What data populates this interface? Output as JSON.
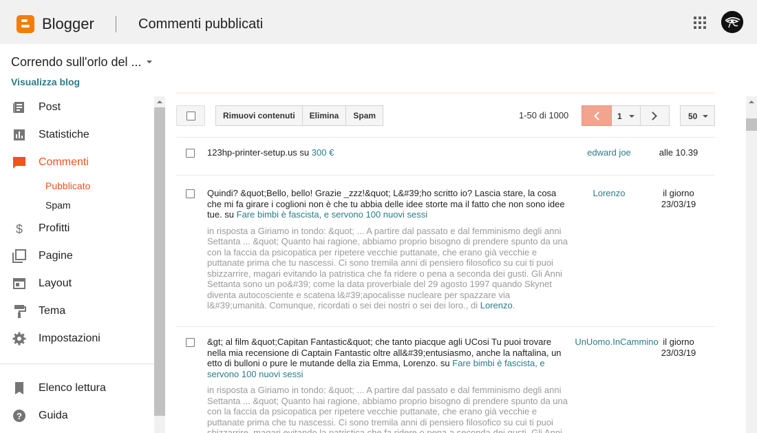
{
  "header": {
    "brand": "Blogger",
    "page_title": "Commenti pubblicati"
  },
  "blog": {
    "name": "Correndo sull'orlo del ...",
    "view_link": "Visualizza blog"
  },
  "sidebar": {
    "items": [
      {
        "label": "Post",
        "icon": "post-icon"
      },
      {
        "label": "Statistiche",
        "icon": "stats-icon"
      },
      {
        "label": "Commenti",
        "icon": "comments-icon"
      },
      {
        "label": "Profitti",
        "icon": "dollar-icon"
      },
      {
        "label": "Pagine",
        "icon": "pages-icon"
      },
      {
        "label": "Layout",
        "icon": "layout-icon"
      },
      {
        "label": "Tema",
        "icon": "paint-roller-icon"
      },
      {
        "label": "Impostazioni",
        "icon": "gear-icon"
      },
      {
        "label": "Elenco lettura",
        "icon": "bookmark-icon"
      },
      {
        "label": "Guida",
        "icon": "help-icon"
      }
    ],
    "sub_items": [
      "Pubblicato",
      "Spam"
    ]
  },
  "toolbar": {
    "remove_content": "Rimuovi contenuti",
    "delete": "Elimina",
    "spam": "Spam",
    "range": "1-50 di 1000",
    "page": "1",
    "per_page": "50"
  },
  "comments": [
    {
      "text": "123hp-printer-setup.us su ",
      "post_link": "300 €",
      "reply": "",
      "author": "edward joe",
      "time": "alle 10.39"
    },
    {
      "text": "Quindi? &quot;Bello, bello! Grazie _zzz!&quot; L&#39;ho scritto io? Lascia stare, la cosa che mi fa girare i coglioni non è che tu abbia delle idee storte ma il fatto che non sono idee tue. su ",
      "post_link": "Fare bimbi è fascista, e servono 100 nuovi sessi",
      "reply": "in risposta a Giriamo in tondo: &quot; ... A partire dal passato e dal femminismo degli anni Settanta ... &quot; Quanto hai ragione, abbiamo proprio bisogno di prendere spunto da una con la faccia da psicopatica per ripetere vecchie puttanate, che erano già vecchie e puttanate prima che tu nascessi. Ci sono tremila anni di pensiero filosofico su cui ti puoi sbizzarrire, magari evitando la patristica che fa ridere o pena a seconda dei gusti. Gli Anni Settanta sono un po&#39; come la data proverbiale del 29 agosto 1997 quando Skynet diventa autocosciente e scatena l&#39;apocalisse nucleare per spazzare via l&#39;umanità. Comunque, ricordati o sei dei nostri o sei dei loro., di ",
      "reply_author": "Lorenzo",
      "author": "Lorenzo",
      "time": "il giorno 23/03/19"
    },
    {
      "text": "&gt; al film &quot;Capitan Fantastic&quot; che tanto piacque agli UCosi Tu puoi trovare nella mia recensione di Captain Fantastic oltre all&#39;entusiasmo, anche la naftalina, un etto di bulloni o pure le mutande della zia Emma, Lorenzo. su ",
      "post_link": "Fare bimbi è fascista, e servono 100 nuovi sessi",
      "reply": "in risposta a Giriamo in tondo: &quot; ... A partire dal passato e dal femminismo degli anni Settanta ... &quot; Quanto hai ragione, abbiamo proprio bisogno di prendere spunto da una con la faccia da psicopatica per ripetere vecchie puttanate, che erano già vecchie e puttanate prima che tu nascessi. Ci sono tremila anni di pensiero filosofico su cui ti puoi sbizzarrire, magari evitando la patristica che fa ridere o pena a seconda dei gusti. Gli Anni",
      "reply_author": "",
      "author": "UnUomo.InCammino",
      "time": "il giorno 23/03/19"
    }
  ],
  "colors": {
    "accent": "#f4511e",
    "link": "#2a7c88",
    "brand": "#f57d00"
  }
}
